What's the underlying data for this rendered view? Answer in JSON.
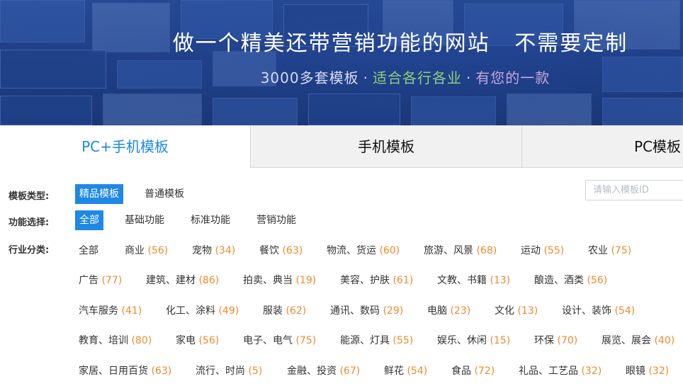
{
  "banner": {
    "title": "做一个精美还带营销功能的网站   不需要定制",
    "subtitle": {
      "part1": "3000多套模板",
      "part2": "适合各行各业",
      "part3": "有您的一款",
      "dot": "·"
    }
  },
  "tabs": [
    {
      "label": "PC+手机模板",
      "active": true
    },
    {
      "label": "手机模板",
      "active": false
    },
    {
      "label": "PC模板",
      "active": false
    }
  ],
  "filters": {
    "type": {
      "label": "模板类型:",
      "options": [
        "精品模板",
        "普通模板"
      ],
      "selected": "精品模板"
    },
    "function": {
      "label": "功能选择:",
      "options": [
        "全部",
        "基础功能",
        "标准功能",
        "营销功能"
      ],
      "selected": "全部"
    },
    "industry": {
      "label": "行业分类:",
      "rows": [
        [
          {
            "name": "全部"
          },
          {
            "name": "商业",
            "count": "56"
          },
          {
            "name": "宠物",
            "count": "34"
          },
          {
            "name": "餐饮",
            "count": "63"
          },
          {
            "name": "物流、货运",
            "count": "60"
          },
          {
            "name": "旅游、风景",
            "count": "68"
          },
          {
            "name": "运动",
            "count": "55"
          },
          {
            "name": "农业",
            "count": "75"
          }
        ],
        [
          {
            "name": "广告",
            "count": "77"
          },
          {
            "name": "建筑、建材",
            "count": "86"
          },
          {
            "name": "拍卖、典当",
            "count": "19"
          },
          {
            "name": "美容、护肤",
            "count": "61"
          },
          {
            "name": "文教、书籍",
            "count": "13"
          },
          {
            "name": "酿造、酒类",
            "count": "56"
          }
        ],
        [
          {
            "name": "汽车服务",
            "count": "41"
          },
          {
            "name": "化工、涂料",
            "count": "49"
          },
          {
            "name": "服装",
            "count": "62"
          },
          {
            "name": "通讯、数码",
            "count": "29"
          },
          {
            "name": "电脑",
            "count": "23"
          },
          {
            "name": "文化",
            "count": "13"
          },
          {
            "name": "设计、装饰",
            "count": "54"
          }
        ],
        [
          {
            "name": "教育、培训",
            "count": "80"
          },
          {
            "name": "家电",
            "count": "56"
          },
          {
            "name": "电子、电气",
            "count": "75"
          },
          {
            "name": "能源、灯具",
            "count": "55"
          },
          {
            "name": "娱乐、休闲",
            "count": "15"
          },
          {
            "name": "环保",
            "count": "70"
          },
          {
            "name": "展览、展会",
            "count": "40"
          }
        ],
        [
          {
            "name": "家居、日用百货",
            "count": "63"
          },
          {
            "name": "流行、时尚",
            "count": "5"
          },
          {
            "name": "金融、投资",
            "count": "67"
          },
          {
            "name": "鲜花",
            "count": "54"
          },
          {
            "name": "食品",
            "count": "72"
          },
          {
            "name": "礼品、工艺品",
            "count": "32"
          },
          {
            "name": "眼镜",
            "count": "32"
          }
        ]
      ]
    },
    "search": {
      "placeholder": "请输入模板ID",
      "value": ""
    }
  },
  "colors": {
    "accent": "#1e88e5",
    "count": "#ef8a2e",
    "banner_green": "#8fd07a",
    "banner_purple": "#c7a8dc"
  }
}
